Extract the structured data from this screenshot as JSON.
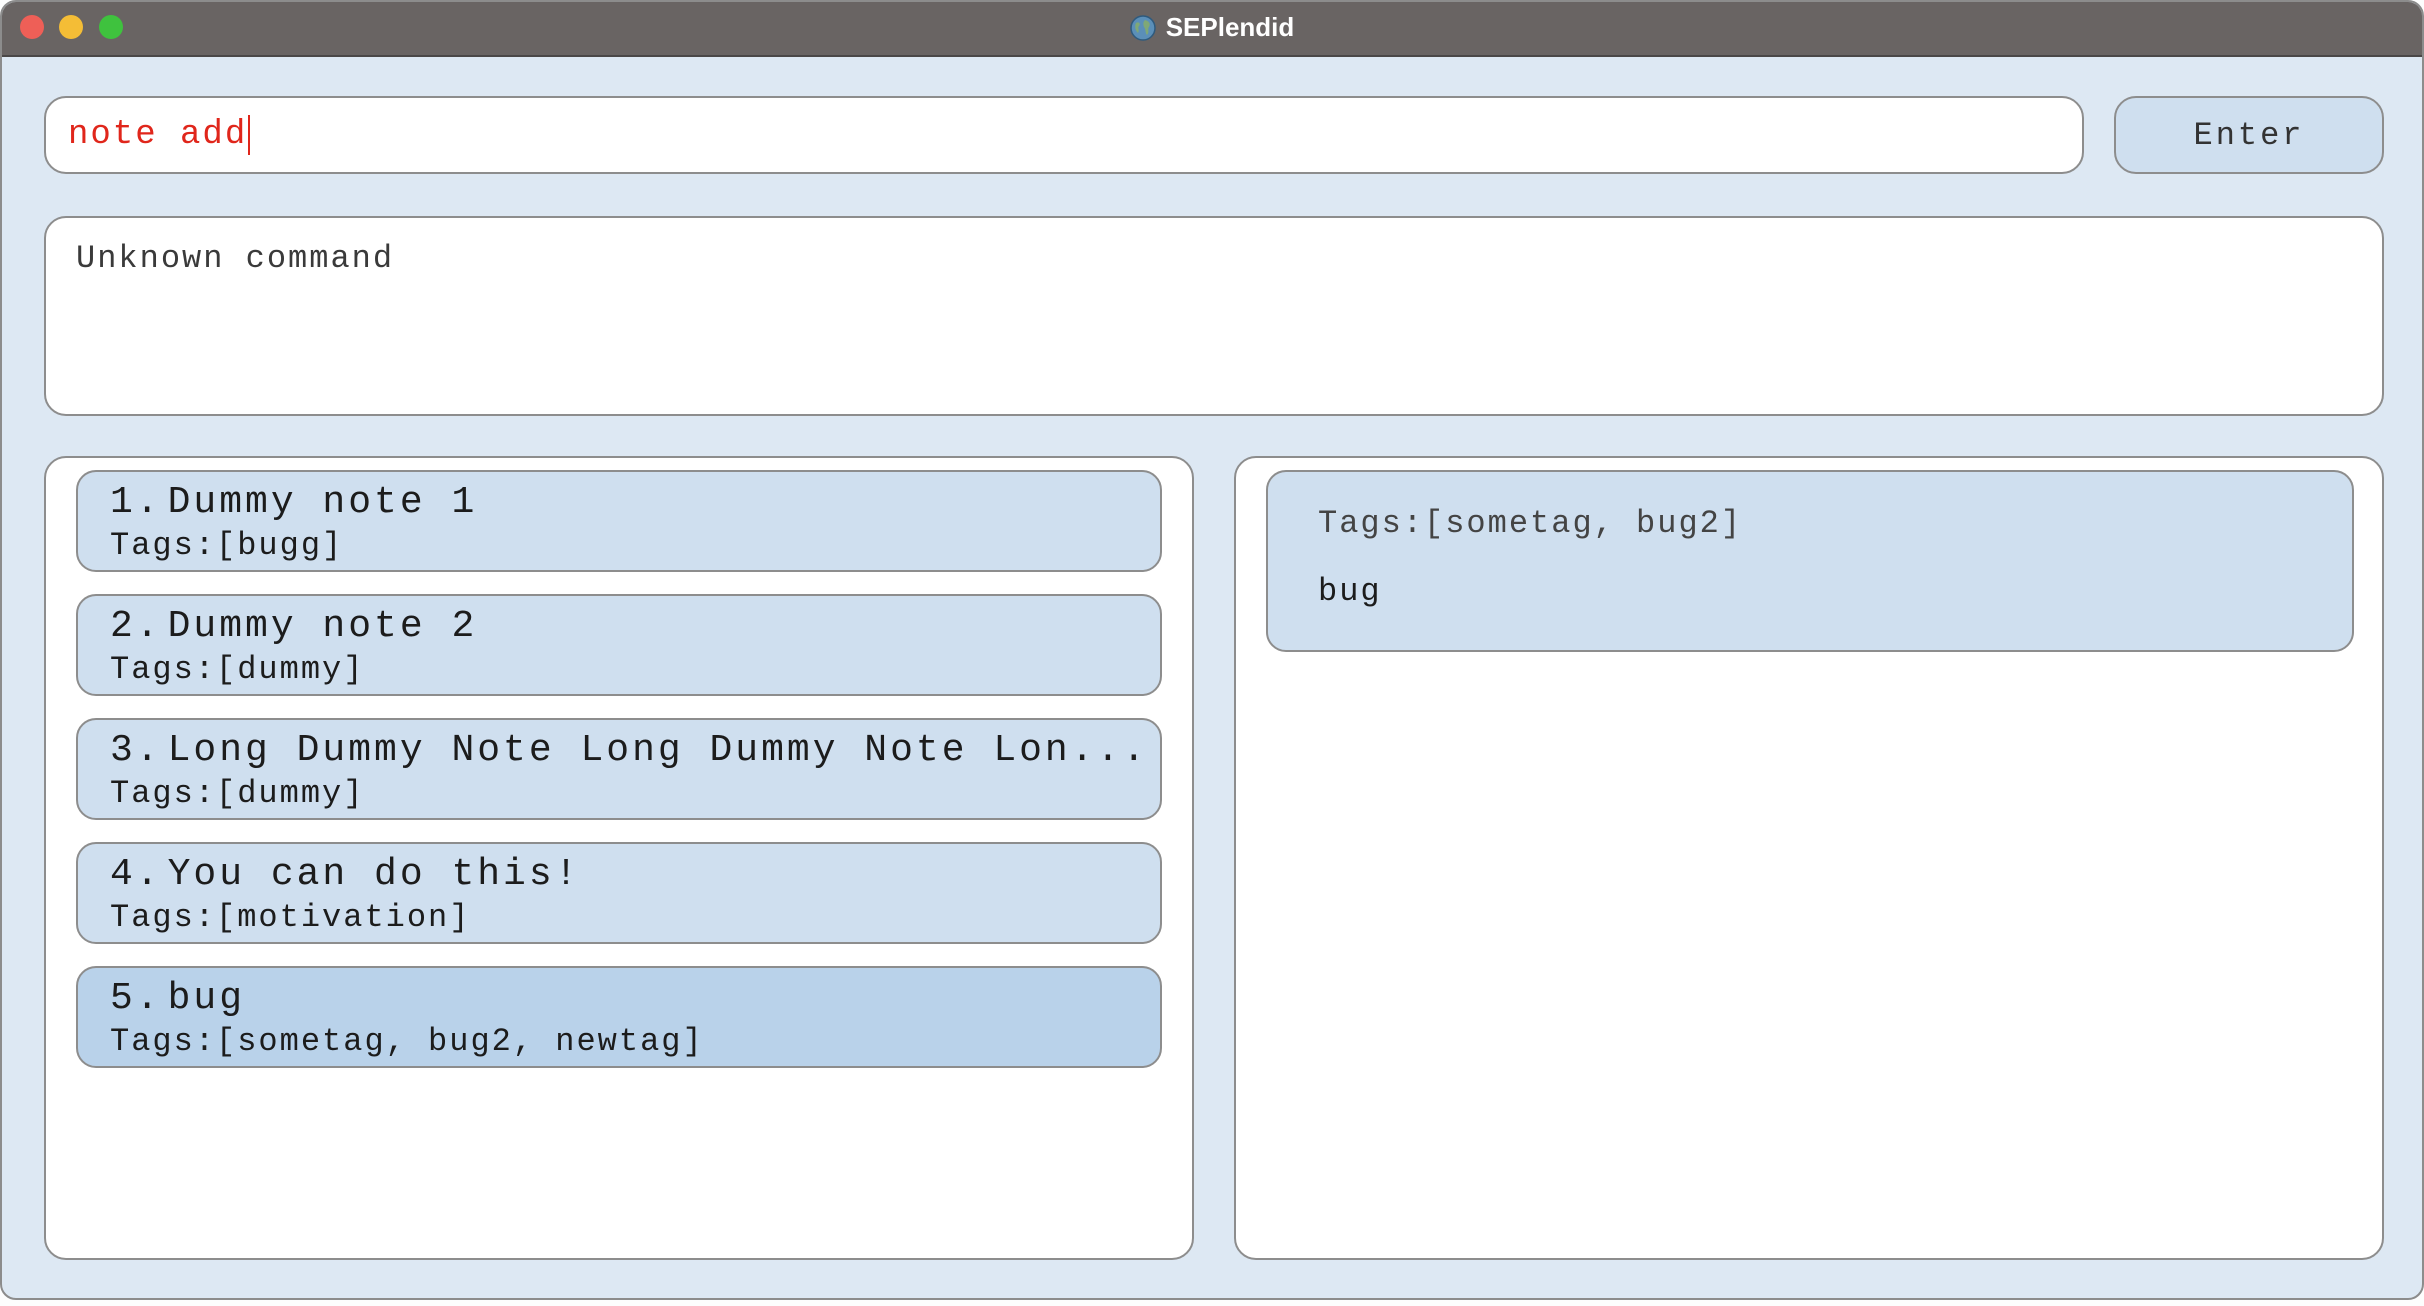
{
  "window": {
    "title": "SEPlendid"
  },
  "command": {
    "value": "note add",
    "enter_label": "Enter"
  },
  "result": {
    "message": "Unknown command"
  },
  "notes": [
    {
      "index": "1.",
      "title": "Dummy note 1",
      "tags": "Tags:[bugg]"
    },
    {
      "index": "2.",
      "title": "Dummy note 2",
      "tags": "Tags:[dummy]"
    },
    {
      "index": "3.",
      "title": "Long Dummy Note Long Dummy Note Lon...",
      "tags": "Tags:[dummy]"
    },
    {
      "index": "4.",
      "title": "You can do this!",
      "tags": "Tags:[motivation]"
    },
    {
      "index": "5.",
      "title": "bug",
      "tags": "Tags:[sometag, bug2, newtag]"
    }
  ],
  "detail": {
    "tags": "Tags:[sometag, bug2]",
    "body": "bug"
  },
  "colors": {
    "accent_text": "#e0261b",
    "card_bg": "#cfdfef",
    "card_selected_bg": "#b9d2ea",
    "window_bg": "#dde8f3"
  }
}
